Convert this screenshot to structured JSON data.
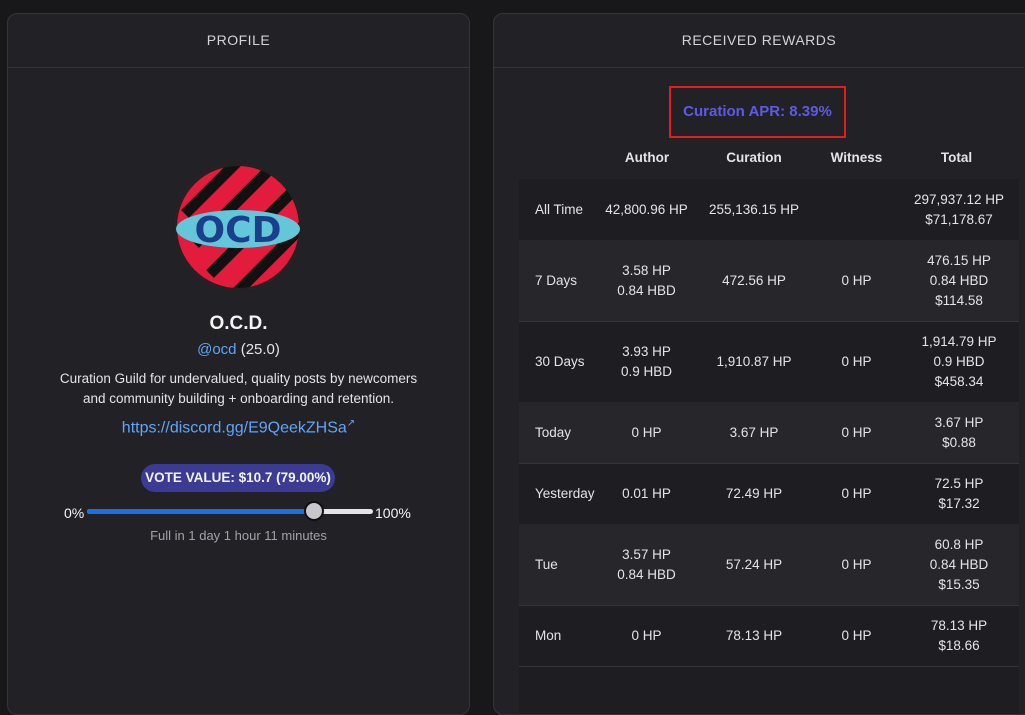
{
  "profile": {
    "header": "PROFILE",
    "name": "O.C.D.",
    "handle": "@ocd",
    "reputation": "(25.0)",
    "description_line1": "Curation Guild for undervalued, quality posts by newcomers",
    "description_line2": "and community building + onboarding and retention.",
    "link": "https://discord.gg/E9QeekZHSa",
    "link_icon": "external-link-icon",
    "vote_value": "VOTE VALUE: $10.7 (79.00%)",
    "slider_min": "0%",
    "slider_max": "100%",
    "voting_power": 0.79,
    "full_in": "Full in 1 day 1 hour 11 minutes",
    "logo_text": "OCD"
  },
  "rewards": {
    "header": "RECEIVED REWARDS",
    "apr": "Curation APR: 8.39%",
    "columns": [
      "Author",
      "Curation",
      "Witness",
      "Total"
    ],
    "rows": [
      {
        "label": "All Time",
        "author": [
          "42,800.96 HP"
        ],
        "curation": [
          "255,136.15 HP"
        ],
        "witness": [
          ""
        ],
        "total": [
          "297,937.12 HP",
          "$71,178.67"
        ]
      },
      {
        "label": "7 Days",
        "author": [
          "3.58 HP",
          "0.84 HBD"
        ],
        "curation": [
          "472.56 HP"
        ],
        "witness": [
          "0 HP"
        ],
        "total": [
          "476.15 HP",
          "0.84 HBD",
          "$114.58"
        ]
      },
      {
        "label": "30 Days",
        "author": [
          "3.93 HP",
          "0.9 HBD"
        ],
        "curation": [
          "1,910.87 HP"
        ],
        "witness": [
          "0 HP"
        ],
        "total": [
          "1,914.79 HP",
          "0.9 HBD",
          "$458.34"
        ]
      },
      {
        "label": "Today",
        "author": [
          "0 HP"
        ],
        "curation": [
          "3.67 HP"
        ],
        "witness": [
          "0 HP"
        ],
        "total": [
          "3.67 HP",
          "$0.88"
        ]
      },
      {
        "label": "Yesterday",
        "author": [
          "0.01 HP"
        ],
        "curation": [
          "72.49 HP"
        ],
        "witness": [
          "0 HP"
        ],
        "total": [
          "72.5 HP",
          "$17.32"
        ]
      },
      {
        "label": "Tue",
        "author": [
          "3.57 HP",
          "0.84 HBD"
        ],
        "curation": [
          "57.24 HP"
        ],
        "witness": [
          "0 HP"
        ],
        "total": [
          "60.8 HP",
          "0.84 HBD",
          "$15.35"
        ]
      },
      {
        "label": "Mon",
        "author": [
          "0 HP"
        ],
        "curation": [
          "78.13 HP"
        ],
        "witness": [
          "0 HP"
        ],
        "total": [
          "78.13 HP",
          "$18.66"
        ]
      }
    ]
  }
}
